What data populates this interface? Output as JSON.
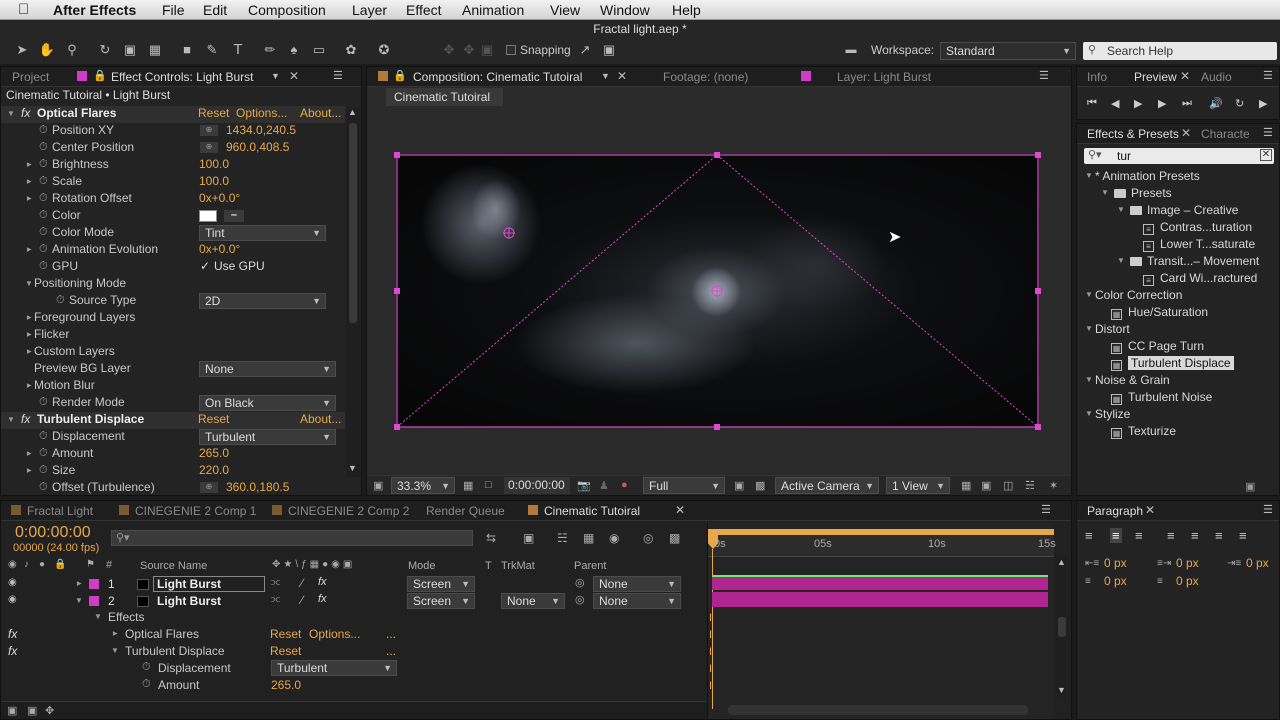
{
  "menubar": {
    "app": "After Effects",
    "items": [
      "File",
      "Edit",
      "Composition",
      "Layer",
      "Effect",
      "Animation",
      "View",
      "Window",
      "Help"
    ]
  },
  "window": {
    "title": "Fractal light.aep *"
  },
  "toolbar": {
    "snapping_label": "Snapping",
    "workspace_label": "Workspace:",
    "workspace_value": "Standard",
    "search_placeholder": "Search Help"
  },
  "effect_controls": {
    "tabs": {
      "project": "Project",
      "effect_controls": "Effect Controls: Light Burst"
    },
    "breadcrumb": "Cinematic Tutoiral • Light Burst",
    "optical_flares": {
      "name": "Optical Flares",
      "reset": "Reset",
      "options": "Options...",
      "about": "About...",
      "props": [
        {
          "label": "Position XY",
          "value": "1434.0,240.5"
        },
        {
          "label": "Center Position",
          "value": "960.0,408.5"
        },
        {
          "label": "Brightness",
          "value": "100.0"
        },
        {
          "label": "Scale",
          "value": "100.0"
        },
        {
          "label": "Rotation Offset",
          "value": "0x+0.0°"
        },
        {
          "label": "Color",
          "value": ""
        },
        {
          "label": "Color Mode",
          "value": "Tint"
        },
        {
          "label": "Animation Evolution",
          "value": "0x+0.0°"
        },
        {
          "label": "GPU",
          "value": "Use GPU"
        }
      ],
      "positioning_mode": "Positioning Mode",
      "source_type_label": "Source Type",
      "source_type_value": "2D",
      "groups": [
        "Foreground Layers",
        "Flicker",
        "Custom Layers"
      ],
      "preview_bg_label": "Preview BG Layer",
      "preview_bg_value": "None",
      "motion_blur": "Motion Blur",
      "render_mode_label": "Render Mode",
      "render_mode_value": "On Black"
    },
    "turbulent_displace": {
      "name": "Turbulent Displace",
      "reset": "Reset",
      "about": "About...",
      "displacement_label": "Displacement",
      "displacement_value": "Turbulent",
      "amount_label": "Amount",
      "amount_value": "265.0",
      "size_label": "Size",
      "size_value": "220.0",
      "offset_label": "Offset (Turbulence)",
      "offset_value": "360.0,180.5"
    }
  },
  "composition": {
    "tabs": {
      "composition": "Composition: Cinematic Tutoiral",
      "footage": "Footage: (none)",
      "layer": "Layer: Light Burst"
    },
    "sub_tab": "Cinematic Tutoiral",
    "footer": {
      "zoom": "33.3%",
      "timecode": "0:00:00:00",
      "resolution": "Full",
      "camera": "Active Camera",
      "views": "1 View"
    }
  },
  "right_panels": {
    "tabs_top": {
      "info": "Info",
      "preview": "Preview",
      "audio": "Audio"
    },
    "tabs_effects": {
      "effects": "Effects & Presets",
      "character": "Characte"
    },
    "search_value": "tur",
    "tree": [
      {
        "label": "* Animation Presets",
        "level": 0,
        "kind": "group"
      },
      {
        "label": "Presets",
        "level": 1,
        "kind": "folder"
      },
      {
        "label": "Image – Creative",
        "level": 2,
        "kind": "folder"
      },
      {
        "label": "Contras...turation",
        "level": 3,
        "kind": "preset"
      },
      {
        "label": "Lower T...saturate",
        "level": 3,
        "kind": "preset"
      },
      {
        "label": "Transit...– Movement",
        "level": 2,
        "kind": "folder"
      },
      {
        "label": "Card Wi...ractured",
        "level": 3,
        "kind": "preset"
      },
      {
        "label": "Color Correction",
        "level": 0,
        "kind": "group"
      },
      {
        "label": "Hue/Saturation",
        "level": 1,
        "kind": "effect"
      },
      {
        "label": "Distort",
        "level": 0,
        "kind": "group"
      },
      {
        "label": "CC Page Turn",
        "level": 1,
        "kind": "effect"
      },
      {
        "label": "Turbulent Displace",
        "level": 1,
        "kind": "effect",
        "selected": true
      },
      {
        "label": "Noise & Grain",
        "level": 0,
        "kind": "group"
      },
      {
        "label": "Turbulent Noise",
        "level": 1,
        "kind": "effect"
      },
      {
        "label": "Stylize",
        "level": 0,
        "kind": "group"
      },
      {
        "label": "Texturize",
        "level": 1,
        "kind": "effect"
      }
    ],
    "paragraph": {
      "tab": "Paragraph",
      "indent_left": "0 px",
      "indent_right": "0 px",
      "indent_first": "0 px",
      "space_before": "0 px",
      "space_after": "0 px"
    }
  },
  "timeline": {
    "tabs": [
      "Fractal Light",
      "CINEGENIE 2 Comp 1",
      "CINEGENIE 2 Comp 2",
      "Render Queue",
      "Cinematic Tutoiral"
    ],
    "timecode": "0:00:00:00",
    "frames": "00000 (24.00 fps)",
    "columns": {
      "source": "Source Name",
      "mode": "Mode",
      "t": "T",
      "trkmat": "TrkMat",
      "parent": "Parent"
    },
    "ruler": [
      "0s",
      "05s",
      "10s",
      "15s"
    ],
    "layers": [
      {
        "num": "1",
        "name": "Light Burst",
        "mode": "Screen",
        "trkmat": "",
        "parent": "None"
      },
      {
        "num": "2",
        "name": "Light Burst",
        "mode": "Screen",
        "trkmat": "None",
        "parent": "None"
      }
    ],
    "effects_label": "Effects",
    "fx_rows": {
      "optical": "Optical Flares",
      "optical_reset": "Reset",
      "optical_options": "Options...",
      "optical_more": "...",
      "turb": "Turbulent Displace",
      "turb_reset": "Reset",
      "turb_more": "...",
      "displacement_label": "Displacement",
      "displacement_value": "Turbulent",
      "amount_label": "Amount",
      "amount_value": "265.0"
    }
  },
  "colors": {
    "accent": "#e8a84a",
    "label_magenta": "#d23bc8",
    "bar_magenta": "#b0258f"
  }
}
